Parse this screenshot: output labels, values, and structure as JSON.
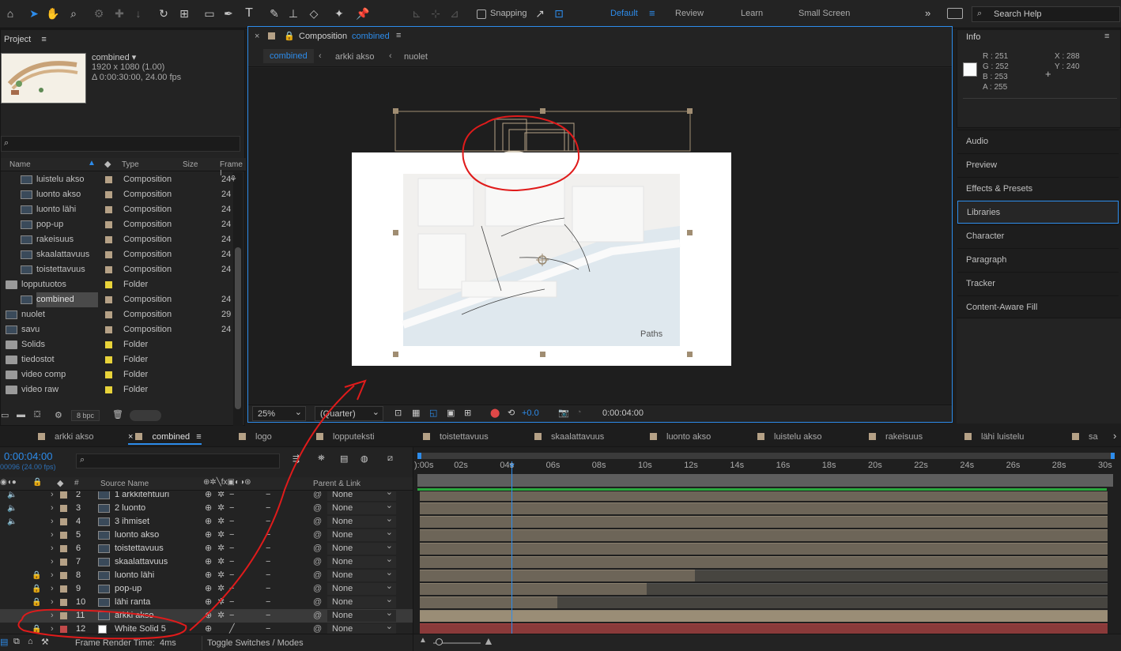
{
  "toolbar": {
    "snapping_label": "Snapping",
    "workspaces": [
      "Default",
      "Review",
      "Learn",
      "Small Screen"
    ],
    "search_placeholder": "Search Help",
    "colors": {
      "accent": "#2d8ceb"
    }
  },
  "project": {
    "title": "Project",
    "comp_name": "combined ▾",
    "comp_res": "1920 x 1080 (1.00)",
    "comp_dur": "Δ 0:00:30:00, 24.00 fps",
    "columns": {
      "name": "Name",
      "type": "Type",
      "size": "Size",
      "frame": "Frame I"
    },
    "items": [
      {
        "name": "luistelu akso",
        "type": "Composition",
        "frame": "24",
        "kind": "comp",
        "indent": 1,
        "swatch": "#b5a186"
      },
      {
        "name": "luonto akso",
        "type": "Composition",
        "frame": "24",
        "kind": "comp",
        "indent": 1,
        "swatch": "#b5a186"
      },
      {
        "name": "luonto lähi",
        "type": "Composition",
        "frame": "24",
        "kind": "comp",
        "indent": 1,
        "swatch": "#b5a186"
      },
      {
        "name": "pop-up",
        "type": "Composition",
        "frame": "24",
        "kind": "comp",
        "indent": 1,
        "swatch": "#b5a186"
      },
      {
        "name": "rakeisuus",
        "type": "Composition",
        "frame": "24",
        "kind": "comp",
        "indent": 1,
        "swatch": "#b5a186"
      },
      {
        "name": "skaalattavuus",
        "type": "Composition",
        "frame": "24",
        "kind": "comp",
        "indent": 1,
        "swatch": "#b5a186"
      },
      {
        "name": "toistettavuus",
        "type": "Composition",
        "frame": "24",
        "kind": "comp",
        "indent": 1,
        "swatch": "#b5a186"
      },
      {
        "name": "lopputuotos",
        "type": "Folder",
        "frame": "",
        "kind": "folder",
        "indent": 0,
        "swatch": "#e8d33a"
      },
      {
        "name": "combined",
        "type": "Composition",
        "frame": "24",
        "kind": "comp",
        "indent": 1,
        "swatch": "#b5a186",
        "selected": true
      },
      {
        "name": "nuolet",
        "type": "Composition",
        "frame": "29",
        "kind": "comp",
        "indent": 0,
        "swatch": "#b5a186"
      },
      {
        "name": "savu",
        "type": "Composition",
        "frame": "24",
        "kind": "comp",
        "indent": 0,
        "swatch": "#b5a186"
      },
      {
        "name": "Solids",
        "type": "Folder",
        "frame": "",
        "kind": "folder",
        "indent": 0,
        "swatch": "#e8d33a"
      },
      {
        "name": "tiedostot",
        "type": "Folder",
        "frame": "",
        "kind": "folder",
        "indent": 0,
        "swatch": "#e8d33a"
      },
      {
        "name": "video comp",
        "type": "Folder",
        "frame": "",
        "kind": "folder",
        "indent": 0,
        "swatch": "#e8d33a"
      },
      {
        "name": "video raw",
        "type": "Folder",
        "frame": "",
        "kind": "folder",
        "indent": 0,
        "swatch": "#e8d33a"
      }
    ],
    "bpc": "8 bpc"
  },
  "composition": {
    "title_prefix": "Composition",
    "title_name": "combined",
    "breadcrumbs": [
      "combined",
      "arkki akso",
      "nuolet"
    ],
    "canvas_label": "Paths",
    "zoom": "25%",
    "resolution": "(Quarter)",
    "exposure": "+0.0",
    "timecode": "0:00:04:00"
  },
  "info": {
    "title": "Info",
    "r": "R :  251",
    "g": "G :  252",
    "b": "B :  253",
    "a": "A :  255",
    "x": "X : 288",
    "y": "Y : 240"
  },
  "right_panels": [
    "Audio",
    "Preview",
    "Effects & Presets",
    "Libraries",
    "Character",
    "Paragraph",
    "Tracker",
    "Content-Aware Fill"
  ],
  "timeline": {
    "tabs": [
      "arkki akso",
      "combined",
      "logo",
      "lopputeksti",
      "toistettavuus",
      "skaalattavuus",
      "luonto akso",
      "luistelu akso",
      "rakeisuus",
      "lähi luistelu",
      "sa"
    ],
    "timecode": "0:00:04:00",
    "frame_info": "00096 (24.00 fps)",
    "columns": {
      "source": "Source Name",
      "parent": "Parent & Link"
    },
    "ruler": [
      "):00s",
      "02s",
      "04s",
      "06s",
      "08s",
      "10s",
      "12s",
      "14s",
      "16s",
      "18s",
      "20s",
      "22s",
      "24s",
      "26s",
      "28s",
      "30s"
    ],
    "layers": [
      {
        "num": "2",
        "name": "1 arkkitehtuuri",
        "parent": "None",
        "audio": true,
        "bar_end": 1.0
      },
      {
        "num": "3",
        "name": "2 luonto",
        "parent": "None",
        "audio": true,
        "bar_end": 1.0
      },
      {
        "num": "4",
        "name": "3 ihmiset",
        "parent": "None",
        "audio": true,
        "bar_end": 1.0
      },
      {
        "num": "5",
        "name": "luonto akso",
        "parent": "None",
        "bar_end": 1.0
      },
      {
        "num": "6",
        "name": "toistettavuus",
        "parent": "None",
        "bar_end": 1.0
      },
      {
        "num": "7",
        "name": "skaalattavuus",
        "parent": "None",
        "bar_end": 1.0
      },
      {
        "num": "8",
        "name": "luonto lähi",
        "parent": "None",
        "locked": true,
        "bar_end": 0.4
      },
      {
        "num": "9",
        "name": "pop-up",
        "parent": "None",
        "locked": true,
        "bar_end": 0.33
      },
      {
        "num": "10",
        "name": "lähi ranta",
        "parent": "None",
        "locked": true,
        "bar_end": 0.2
      },
      {
        "num": "11",
        "name": "arkki akso",
        "parent": "None",
        "selected": true,
        "bar_end": 1.0
      },
      {
        "num": "12",
        "name": "White Solid 5",
        "parent": "None",
        "locked": true,
        "solid": true,
        "bar_end": 1.0
      }
    ],
    "frame_render_label": "Frame Render Time:",
    "frame_render_value": "4ms",
    "toggle_label": "Toggle Switches / Modes"
  }
}
